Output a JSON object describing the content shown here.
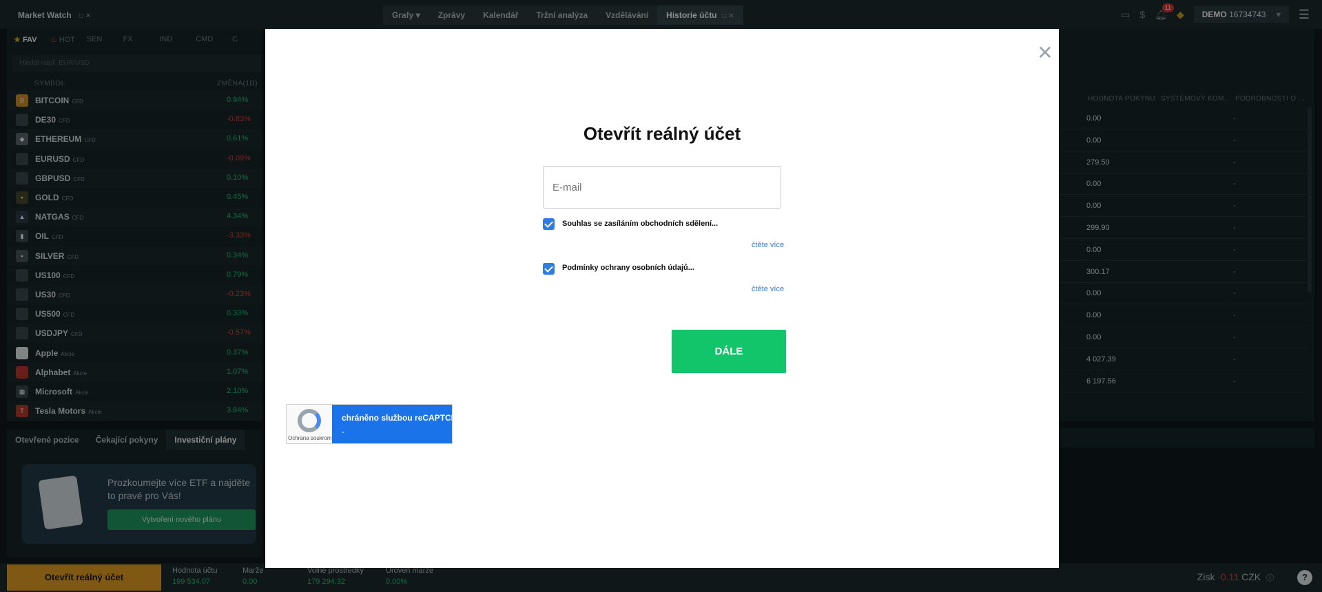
{
  "topbar": {
    "window_title": "Market Watch",
    "tabs": [
      "Grafy",
      "Zprávy",
      "Kalendář",
      "Tržní analýza",
      "Vzdělávání",
      "Historie účtu"
    ],
    "notification_count": "11",
    "account_type": "DEMO",
    "account_number": "16734743"
  },
  "watchlist": {
    "categories": [
      "FAV",
      "HOT",
      "SEN",
      "FX",
      "IND",
      "CMD",
      "C"
    ],
    "search_placeholder": "Hledat např. EUR/USD",
    "col_symbol": "SYMBOL",
    "col_change": "ZMĚNA(1D)",
    "rows": [
      {
        "name": "BITCOIN",
        "type": "CFD",
        "change": "0.94%",
        "dir": "pos",
        "icon": "B",
        "color": "#d4941e"
      },
      {
        "name": "DE30",
        "type": "CFD",
        "change": "-0.83%",
        "dir": "neg",
        "icon": "",
        "color": "#3a4b50"
      },
      {
        "name": "ETHEREUM",
        "type": "CFD",
        "change": "0.61%",
        "dir": "pos",
        "icon": "◆",
        "color": "#5b6b70"
      },
      {
        "name": "EURUSD",
        "type": "CFD",
        "change": "-0.09%",
        "dir": "neg",
        "icon": "",
        "color": "#3a4b50"
      },
      {
        "name": "GBPUSD",
        "type": "CFD",
        "change": "0.10%",
        "dir": "pos",
        "icon": "",
        "color": "#3a4b50"
      },
      {
        "name": "GOLD",
        "type": "CFD",
        "change": "0.45%",
        "dir": "pos",
        "icon": "▪",
        "color": "#4a4a2a"
      },
      {
        "name": "NATGAS",
        "type": "CFD",
        "change": "4.34%",
        "dir": "pos",
        "icon": "▲",
        "color": "#2f3e4a"
      },
      {
        "name": "OIL",
        "type": "CFD",
        "change": "-3.33%",
        "dir": "neg",
        "icon": "▮",
        "color": "#3a4b50"
      },
      {
        "name": "SILVER",
        "type": "CFD",
        "change": "0.34%",
        "dir": "pos",
        "icon": "▪",
        "color": "#4b5559"
      },
      {
        "name": "US100",
        "type": "CFD",
        "change": "0.79%",
        "dir": "pos",
        "icon": "",
        "color": "#3a4b50"
      },
      {
        "name": "US30",
        "type": "CFD",
        "change": "-0.23%",
        "dir": "neg",
        "icon": "",
        "color": "#3a4b50"
      },
      {
        "name": "US500",
        "type": "CFD",
        "change": "0.33%",
        "dir": "pos",
        "icon": "",
        "color": "#3a4b50"
      },
      {
        "name": "USDJPY",
        "type": "CFD",
        "change": "-0.57%",
        "dir": "neg",
        "icon": "",
        "color": "#3a4b50"
      },
      {
        "name": "Apple",
        "type": "Akcie",
        "change": "0.37%",
        "dir": "pos",
        "icon": "",
        "color": "#e8eef0"
      },
      {
        "name": "Alphabet",
        "type": "Akcie",
        "change": "1.07%",
        "dir": "pos",
        "icon": "",
        "color": "#c0392b"
      },
      {
        "name": "Microsoft",
        "type": "Akcie",
        "change": "2.10%",
        "dir": "pos",
        "icon": "▦",
        "color": "#3a4b50"
      },
      {
        "name": "Tesla Motors",
        "type": "Akcie",
        "change": "3.84%",
        "dir": "pos",
        "icon": "T",
        "color": "#c0392b"
      }
    ]
  },
  "bottom_panel": {
    "tabs": [
      "Otevřené pozice",
      "Čekající pokyny",
      "Investiční plány"
    ],
    "promo_text": "Prozkoumejte více ETF a najděte to pravé pro Vás!",
    "promo_button": "Vytvoření nového plánu"
  },
  "right_panel": {
    "headers": [
      "HODNOTA POKYNU",
      "SYSTÉMOVÝ KOM...",
      "PODROBNOSTI O ..."
    ],
    "rows": [
      "0.00",
      "0.00",
      "279.50",
      "0.00",
      "0.00",
      "299.90",
      "0.00",
      "300.17",
      "0.00",
      "0.00",
      "0.00",
      "4 027.39",
      "6 197.56"
    ],
    "dash": "-"
  },
  "statusbar": {
    "open_real_label": "Otevřít reálný účet",
    "stats": [
      {
        "label": "Hodnota účtu",
        "value": "199 534.07"
      },
      {
        "label": "Marže",
        "value": "0.00"
      },
      {
        "label": "Volné prostředky",
        "value": "179 294.32"
      },
      {
        "label": "Úroveň marže",
        "value": "0.00%"
      }
    ],
    "profit_label": "Zisk",
    "profit_value": "-0.11",
    "profit_currency": "CZK"
  },
  "modal": {
    "title": "Otevřít reálný účet",
    "email_placeholder": "E-mail",
    "consent1": "Souhlas se zasíláním obchodních sdělení...",
    "consent2": "Podmínky ochrany osobních údajů...",
    "read_more": "čtěte více",
    "next_button": "DÁLE",
    "recaptcha_text": "chráněno službou reCAPTCHA",
    "recaptcha_dash": "-",
    "recaptcha_small": "Ochrana soukromí"
  }
}
